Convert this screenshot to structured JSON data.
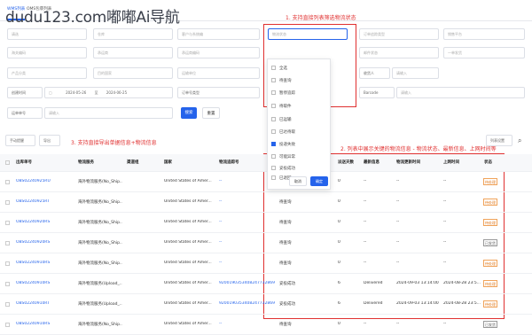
{
  "watermark": "dudu123.com嘟嘟Ai导航",
  "tabs": [
    "WMS列表",
    "OMS包裹列表"
  ],
  "annotations": {
    "a1": "1. 支持直接列表筛选物流状态",
    "a2": "3. 支持直接导出单据信息+物流信息",
    "a3": "2. 列表中展示关键的物流信息 - 物流状态、最新信息、上网时间等"
  },
  "filters": {
    "row1": [
      "请选",
      "仓库",
      "客户与系统编",
      "处理状态",
      "物流状态",
      "订单追踪类型",
      "销售平台"
    ],
    "row2": [
      "海关编码",
      "承运商",
      "承运商编码",
      "快递公司",
      "",
      "",
      "邮件状态",
      "一单发货"
    ],
    "row3": [
      "产品分类",
      "目的国家",
      "运输单位",
      "",
      "收货人",
      "请输入"
    ],
    "row4_label": "创建时间",
    "date_start": "2024-05-26",
    "date_sep": "至",
    "date_end": "2024-06-25",
    "order_type": "订单号类型",
    "barcode_label": "Barcode",
    "barcode_ph": "请输入",
    "shipno_label": "运单单号",
    "shipno_ph": "请输入",
    "search": "搜索",
    "reset": "重置"
  },
  "dropdown": {
    "items": [
      {
        "label": "全选",
        "checked": false
      },
      {
        "label": "待查询",
        "checked": false
      },
      {
        "label": "暂停追踪",
        "checked": false
      },
      {
        "label": "待取件",
        "checked": false
      },
      {
        "label": "已运输",
        "checked": false
      },
      {
        "label": "已达待取",
        "checked": false
      },
      {
        "label": "投递失败",
        "checked": true
      },
      {
        "label": "可能异常",
        "checked": false
      },
      {
        "label": "妥投成功",
        "checked": false
      },
      {
        "label": "已退回",
        "checked": false
      }
    ],
    "cancel": "取消",
    "confirm": "确定"
  },
  "toolbar": {
    "batch": "手动提醒",
    "export": "导出",
    "column_set": "列表设置"
  },
  "columns": [
    "出库单号",
    "物流服务",
    "渠道组",
    "国家",
    "物流追踪号",
    "物流状态",
    "派送天数",
    "最新信息",
    "物流更新时间",
    "上网时间",
    "状态"
  ],
  "rows": [
    {
      "order": "OBS02240925RU",
      "service": "海外物流服务(No_Ship...",
      "country": "United States of Amer...",
      "tracking": "--",
      "lstatus": "待查询",
      "days": "0",
      "info": "--",
      "updated": "--",
      "online": "--",
      "status": "待处理",
      "grey": false
    },
    {
      "order": "OBS02240925RT",
      "service": "海外物流服务(No_Ship...",
      "country": "United States of Amer...",
      "tracking": "--",
      "lstatus": "待查询",
      "days": "0",
      "info": "--",
      "updated": "--",
      "online": "--",
      "status": "待处理",
      "grey": false
    },
    {
      "order": "OBS02240920RS",
      "service": "海外物流服务(No_Ship...",
      "country": "United States of Amer...",
      "tracking": "--",
      "lstatus": "待查询",
      "days": "0",
      "info": "--",
      "updated": "--",
      "online": "--",
      "status": "待处理",
      "grey": false
    },
    {
      "order": "OBS02240920RS",
      "service": "海外物流服务(No_Ship...",
      "country": "United States of Amer...",
      "tracking": "--",
      "lstatus": "待查询",
      "days": "0",
      "info": "--",
      "updated": "--",
      "online": "--",
      "status": "已发货",
      "grey": true
    },
    {
      "order": "OBS02240910RS",
      "service": "海外物流服务(No_Ship...",
      "country": "United States of Amer...",
      "tracking": "--",
      "lstatus": "待查询",
      "days": "0",
      "info": "--",
      "updated": "--",
      "online": "--",
      "status": "待处理",
      "grey": false
    },
    {
      "order": "OBS02240910RS",
      "service": "海外物流服务(Upload_...",
      "country": "United States of Amer...",
      "tracking": "9200190353408247732869",
      "lstatus": "妥投成功",
      "days": "6",
      "info": "Delivered",
      "updated": "2024-09-03 13:14:00",
      "online": "2024-08-28 23:5...",
      "status": "待处理",
      "grey": false
    },
    {
      "order": "OBS02240910RT",
      "service": "海外物流服务(Upload_...",
      "country": "United States of Amer...",
      "tracking": "9200190353408247732869",
      "lstatus": "妥投成功",
      "days": "6",
      "info": "Delivered",
      "updated": "2024-09-03 13:14:00",
      "online": "2024-08-28 23:5...",
      "status": "待处理",
      "grey": false
    },
    {
      "order": "OBS02240910RS",
      "service": "海外物流服务(No_Ship...",
      "country": "United States of Amer...",
      "tracking": "--",
      "lstatus": "待查询",
      "days": "0",
      "info": "--",
      "updated": "--",
      "online": "--",
      "status": "已发货",
      "grey": true
    }
  ]
}
